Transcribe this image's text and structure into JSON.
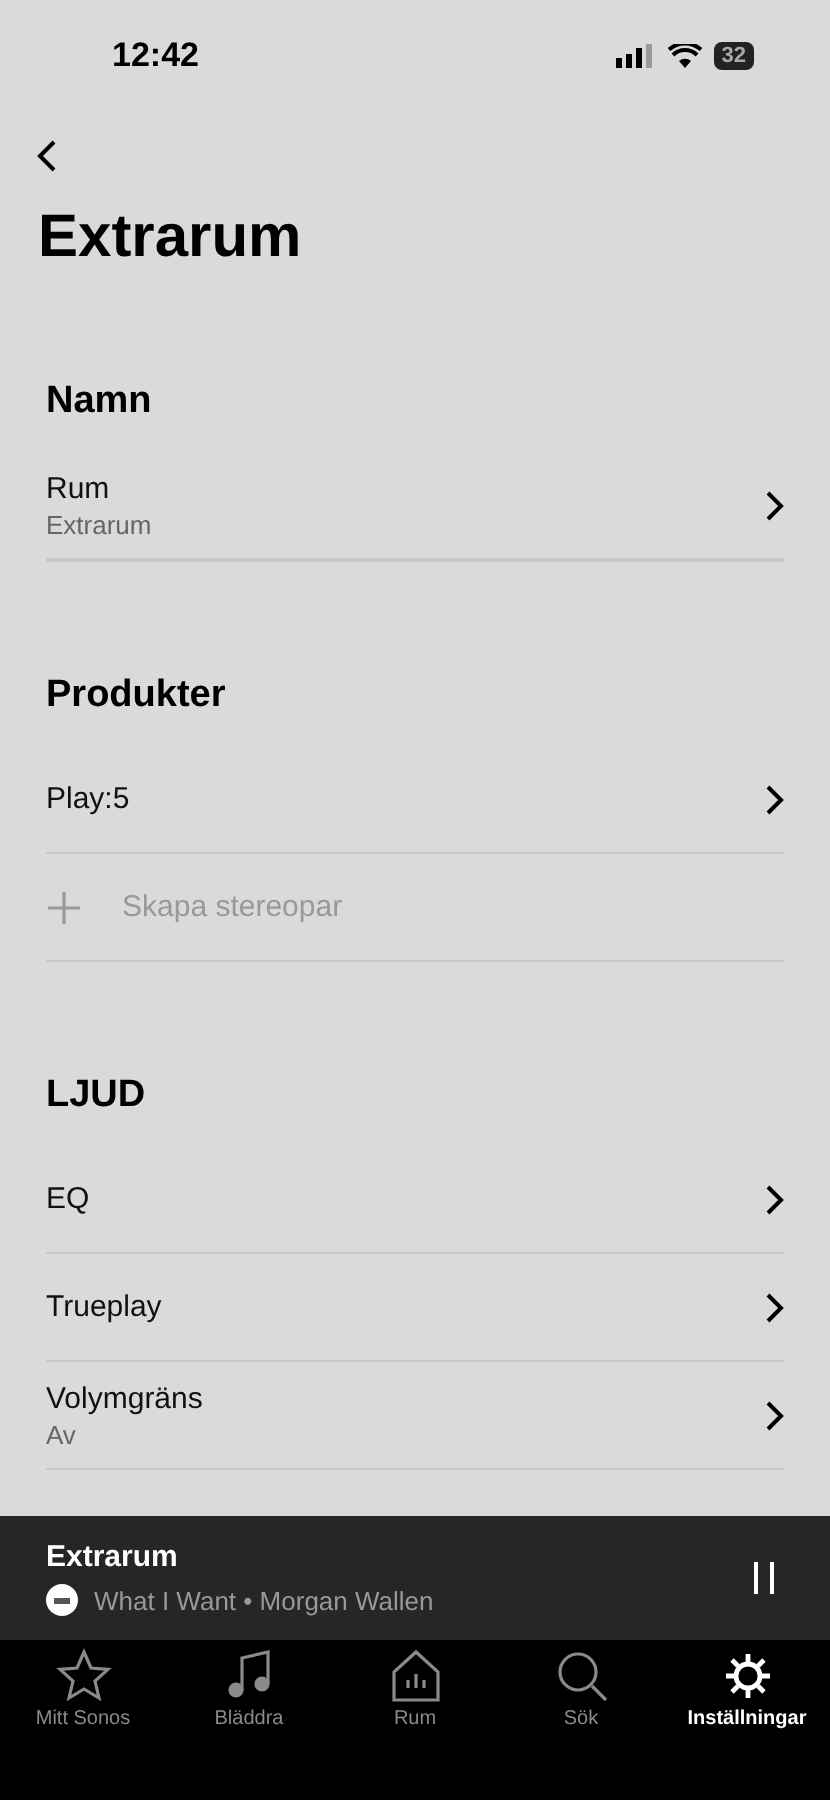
{
  "status_bar": {
    "time": "12:42",
    "battery": "32"
  },
  "title": "Extrarum",
  "sections": [
    {
      "heading": "Namn",
      "rows": [
        {
          "kind": "nav",
          "label": "Rum",
          "sublabel": "Extrarum"
        }
      ]
    },
    {
      "heading": "Produkter",
      "rows": [
        {
          "kind": "nav",
          "label": "Play:5"
        },
        {
          "kind": "action",
          "label": "Skapa stereopar",
          "disabled": true
        }
      ]
    },
    {
      "heading": "LJUD",
      "rows": [
        {
          "kind": "nav",
          "label": "EQ"
        },
        {
          "kind": "nav",
          "label": "Trueplay"
        },
        {
          "kind": "nav",
          "label": "Volymgräns",
          "sublabel": "Av"
        }
      ]
    }
  ],
  "now_playing": {
    "room": "Extrarum",
    "track": "What I Want • Morgan Wallen"
  },
  "tabs": [
    {
      "label": "Mitt Sonos",
      "selected": false
    },
    {
      "label": "Bläddra",
      "selected": false
    },
    {
      "label": "Rum",
      "selected": false
    },
    {
      "label": "Sök",
      "selected": false
    },
    {
      "label": "Inställningar",
      "selected": true
    }
  ]
}
